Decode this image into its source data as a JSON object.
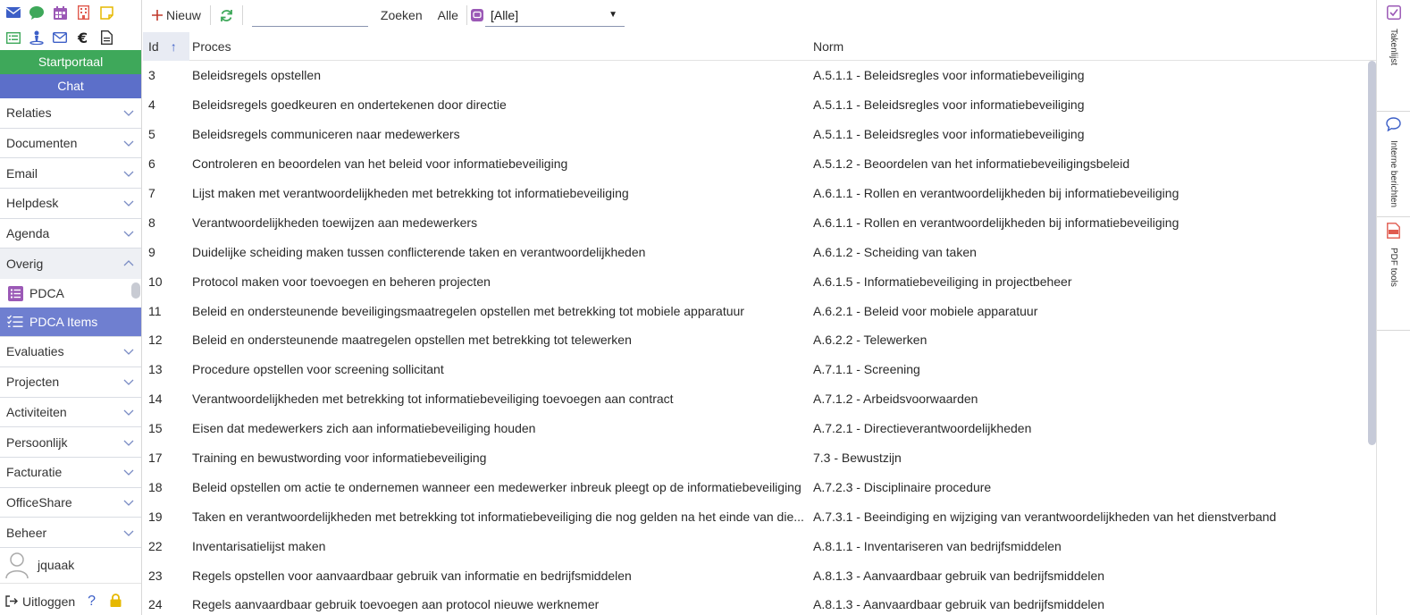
{
  "sidebar": {
    "portal_label": "Startportaal",
    "chat_label": "Chat",
    "nav_top": [
      {
        "label": "Relaties"
      },
      {
        "label": "Documenten"
      },
      {
        "label": "Email"
      },
      {
        "label": "Helpdesk"
      },
      {
        "label": "Agenda"
      }
    ],
    "overig": {
      "label": "Overig"
    },
    "sub_items": [
      {
        "label": "PDCA"
      },
      {
        "label": "PDCA Items"
      }
    ],
    "nav_bottom": [
      {
        "label": "Evaluaties"
      },
      {
        "label": "Projecten"
      },
      {
        "label": "Activiteiten"
      },
      {
        "label": "Persoonlijk"
      },
      {
        "label": "Facturatie"
      },
      {
        "label": "OfficeShare"
      },
      {
        "label": "Beheer"
      }
    ],
    "username": "jquaak",
    "logout_label": "Uitloggen",
    "help_label": "?"
  },
  "toolbar": {
    "new_label": "Nieuw",
    "search_value": "",
    "search_label": "Zoeken",
    "all_label": "Alle",
    "filter_value": "[Alle]"
  },
  "grid": {
    "headers": {
      "id": "Id",
      "proces": "Proces",
      "norm": "Norm"
    },
    "rows": [
      {
        "id": "3",
        "proces": "Beleidsregels opstellen",
        "norm": "A.5.1.1 - Beleidsregles voor informatiebeveiliging"
      },
      {
        "id": "4",
        "proces": "Beleidsregels goedkeuren en ondertekenen door directie",
        "norm": "A.5.1.1 - Beleidsregles voor informatiebeveiliging"
      },
      {
        "id": "5",
        "proces": "Beleidsregels communiceren naar medewerkers",
        "norm": "A.5.1.1 - Beleidsregles voor informatiebeveiliging"
      },
      {
        "id": "6",
        "proces": "Controleren en beoordelen van het beleid voor informatiebeveiliging",
        "norm": "A.5.1.2 - Beoordelen van het informatiebeveiligingsbeleid"
      },
      {
        "id": "7",
        "proces": "Lijst maken met verantwoordelijkheden met betrekking tot informatiebeveiliging",
        "norm": "A.6.1.1 - Rollen en verantwoordelijkheden bij informatiebeveiliging"
      },
      {
        "id": "8",
        "proces": "Verantwoordelijkheden toewijzen aan medewerkers",
        "norm": "A.6.1.1 - Rollen en verantwoordelijkheden bij informatiebeveiliging"
      },
      {
        "id": "9",
        "proces": "Duidelijke scheiding maken tussen conflicterende taken en verantwoordelijkheden",
        "norm": "A.6.1.2 - Scheiding van taken"
      },
      {
        "id": "10",
        "proces": "Protocol maken voor toevoegen en beheren projecten",
        "norm": "A.6.1.5 - Informatiebeveiliging in projectbeheer"
      },
      {
        "id": "11",
        "proces": "Beleid en ondersteunende beveiligingsmaatregelen opstellen met betrekking tot mobiele apparatuur",
        "norm": "A.6.2.1 - Beleid voor mobiele apparatuur"
      },
      {
        "id": "12",
        "proces": "Beleid en ondersteunende maatregelen opstellen met betrekking tot telewerken",
        "norm": "A.6.2.2 - Telewerken"
      },
      {
        "id": "13",
        "proces": "Procedure opstellen voor screening sollicitant",
        "norm": "A.7.1.1 - Screening"
      },
      {
        "id": "14",
        "proces": "Verantwoordelijkheden met betrekking tot informatiebeveiliging toevoegen aan contract",
        "norm": "A.7.1.2 - Arbeidsvoorwaarden"
      },
      {
        "id": "15",
        "proces": "Eisen dat medewerkers zich aan informatiebeveiliging houden",
        "norm": "A.7.2.1 - Directieverantwoordelijkheden"
      },
      {
        "id": "17",
        "proces": "Training en bewustwording voor informatiebeveiliging",
        "norm": "7.3 - Bewustzijn"
      },
      {
        "id": "18",
        "proces": "Beleid opstellen om actie te ondernemen wanneer een medewerker inbreuk pleegt op de informatiebeveiliging",
        "norm": "A.7.2.3 - Disciplinaire procedure"
      },
      {
        "id": "19",
        "proces": "Taken en verantwoordelijkheden met betrekking tot informatiebeveiliging die nog gelden na het einde van die...",
        "norm": "A.7.3.1 - Beeindiging en wijziging van verantwoordelijkheden van het dienstverband"
      },
      {
        "id": "22",
        "proces": "Inventarisatielijst maken",
        "norm": "A.8.1.1 - Inventariseren van bedrijfsmiddelen"
      },
      {
        "id": "23",
        "proces": "Regels opstellen voor aanvaardbaar gebruik van informatie en bedrijfsmiddelen",
        "norm": "A.8.1.3 - Aanvaardbaar gebruik van bedrijfsmiddelen"
      },
      {
        "id": "24",
        "proces": "Regels aanvaardbaar gebruik toevoegen aan protocol nieuwe werknemer",
        "norm": "A.8.1.3 - Aanvaardbaar gebruik van bedrijfsmiddelen"
      }
    ]
  },
  "rail": {
    "takenlijst_label": "Takenlijst",
    "berichten_label": "Interne berichten",
    "pdf_label": "PDF tools"
  },
  "colors": {
    "portal_green": "#3ea85a",
    "chat_blue": "#5c6fc9",
    "active_item": "#6f7fd0",
    "accent_blue": "#3c5fc7"
  }
}
